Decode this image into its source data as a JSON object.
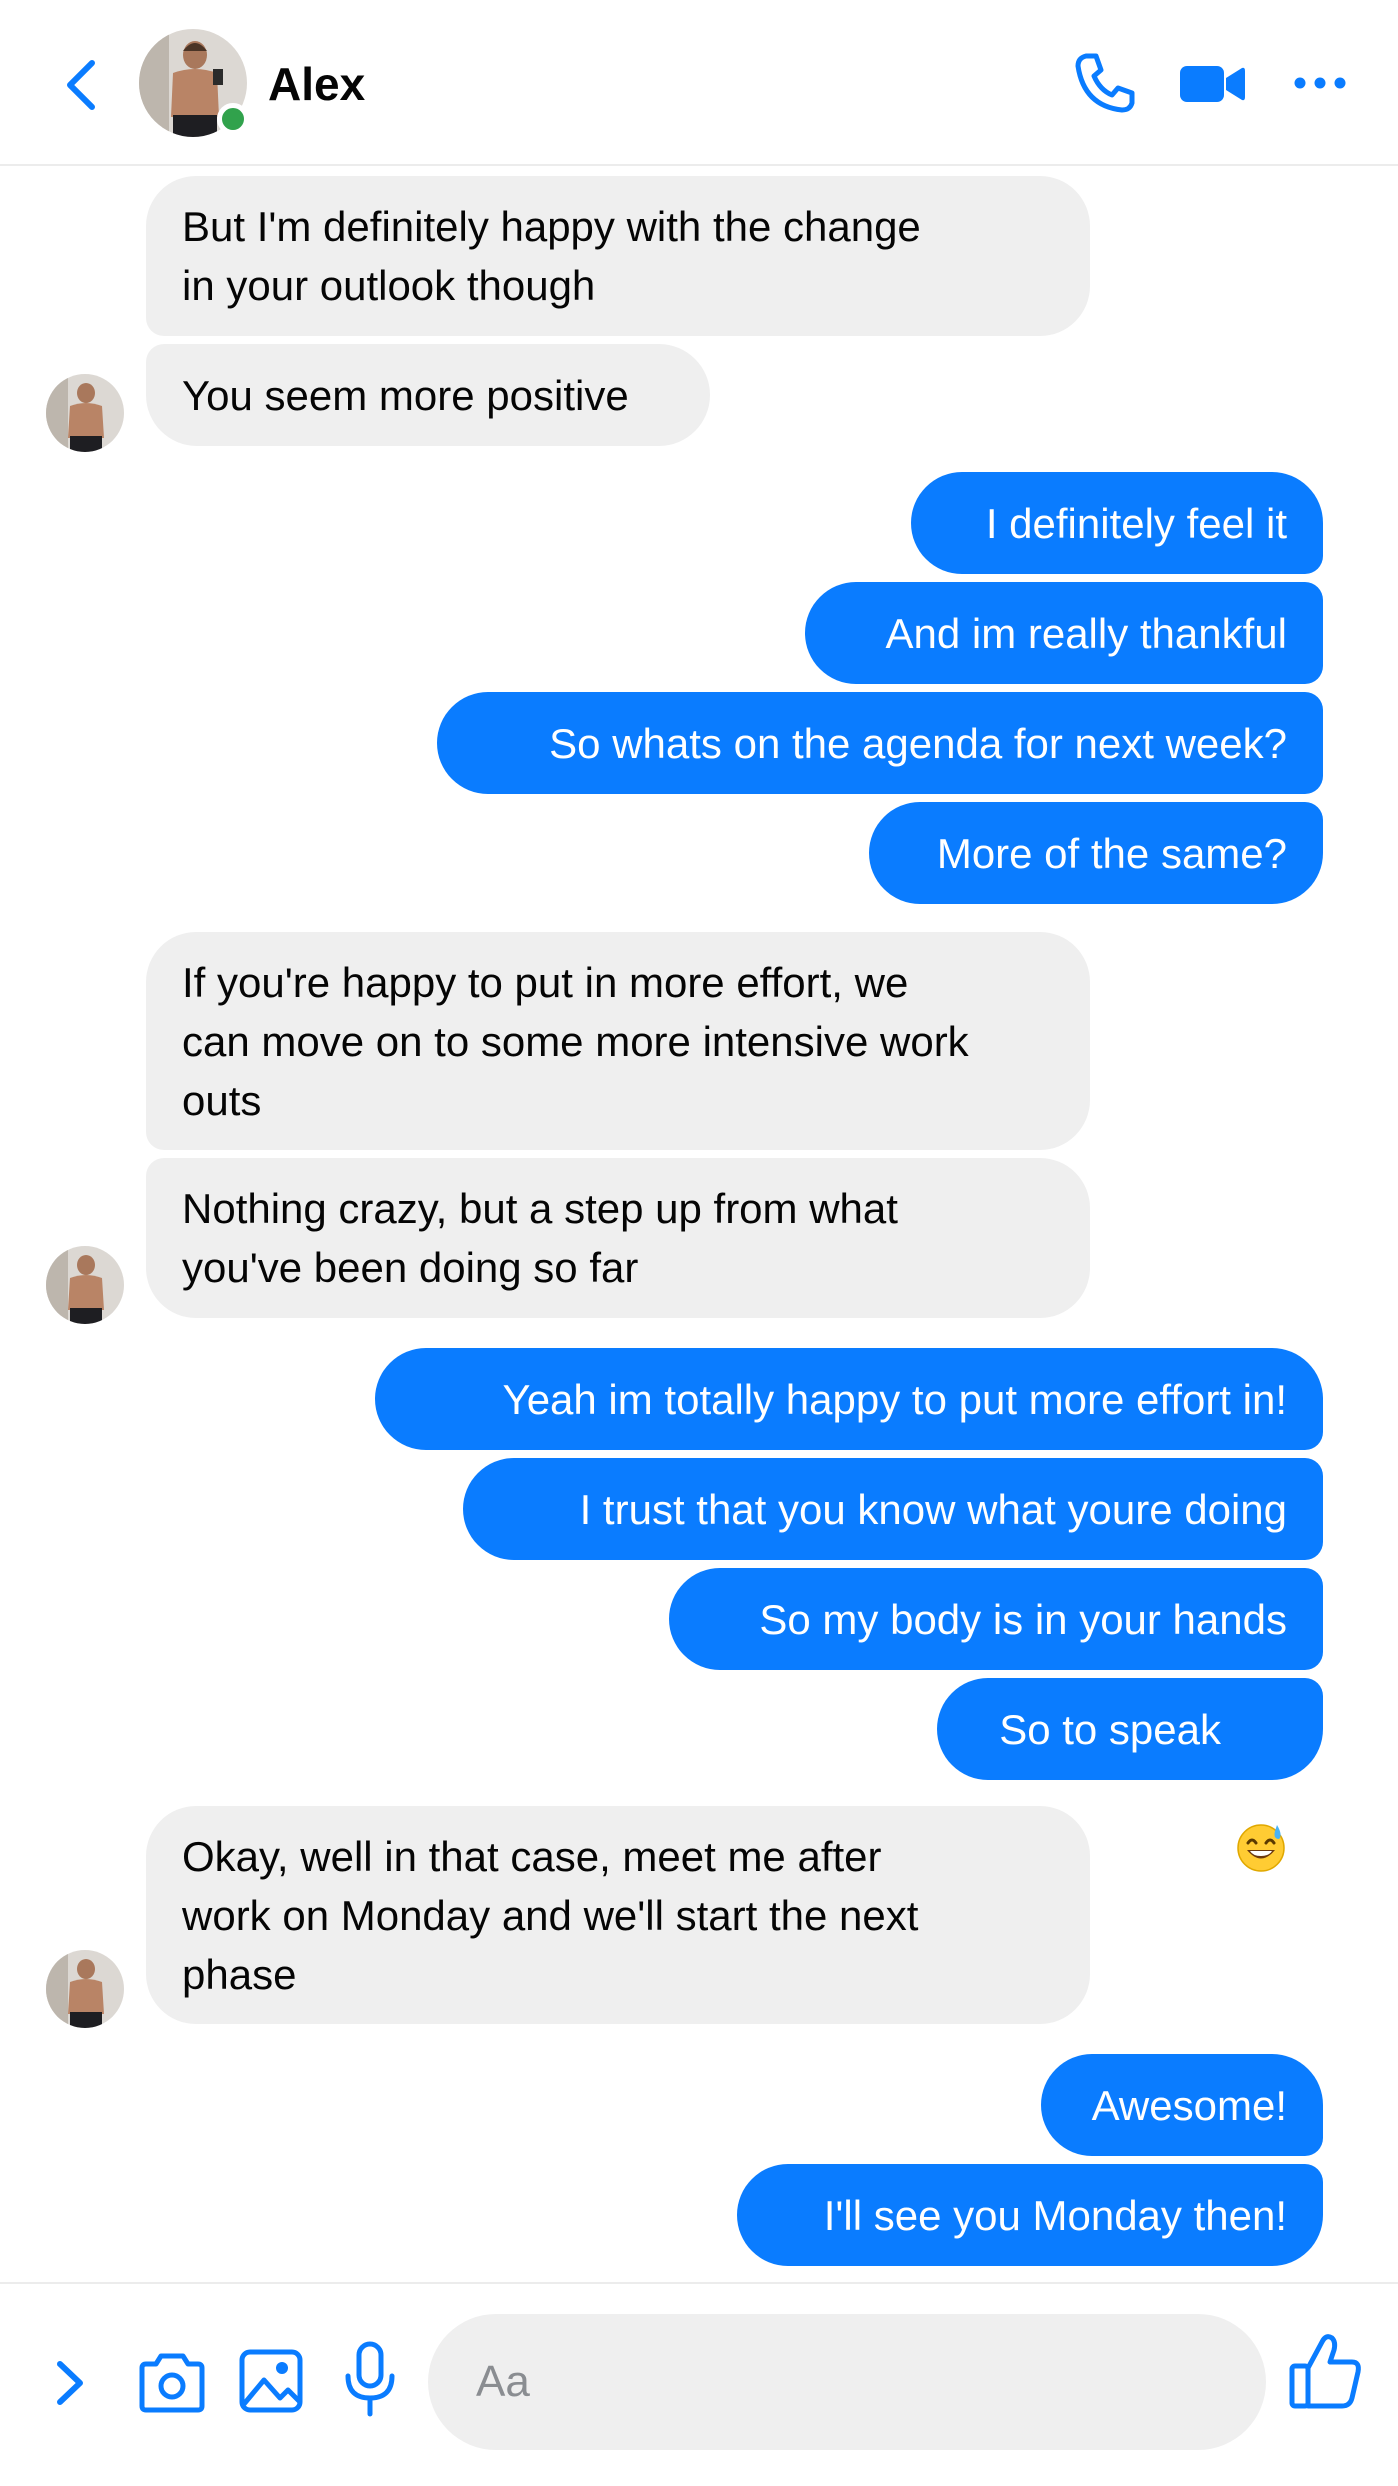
{
  "header": {
    "contact_name": "Alex",
    "online": true,
    "icons": [
      "back-chevron-icon",
      "phone-icon",
      "video-camera-icon",
      "more-dots-icon"
    ]
  },
  "messages": [
    {
      "side": "in",
      "text": "But I'm definitely happy with the change\nin your outlook though"
    },
    {
      "side": "in",
      "text": "You seem more positive"
    },
    {
      "side": "out",
      "text": "I definitely feel it"
    },
    {
      "side": "out",
      "text": "And im really thankful"
    },
    {
      "side": "out",
      "text": "So whats on the agenda for next week?"
    },
    {
      "side": "out",
      "text": "More of the same?"
    },
    {
      "side": "in",
      "text": "If you're happy to put in more effort, we\ncan move on to some more intensive work\nouts"
    },
    {
      "side": "in",
      "text": "Nothing crazy, but a step up from what\nyou've been doing so far"
    },
    {
      "side": "out",
      "text": "Yeah im totally happy to put more effort in!"
    },
    {
      "side": "out",
      "text": "I trust that you know what youre doing"
    },
    {
      "side": "out",
      "text": "So my body is in your hands"
    },
    {
      "side": "out",
      "text": "So to speak",
      "emoji": "grinning-sweat-emoji"
    },
    {
      "side": "in",
      "text": "Okay, well in that case, meet me after\nwork on Monday and we'll start the next\nphase"
    },
    {
      "side": "out",
      "text": "Awesome!"
    },
    {
      "side": "out",
      "text": "I'll see you Monday then!"
    }
  ],
  "composer": {
    "placeholder": "Aa",
    "value": "",
    "icons": [
      "chevron-right-icon",
      "camera-icon",
      "image-gallery-icon",
      "microphone-icon",
      "thumbs-up-icon"
    ]
  },
  "colors": {
    "accent": "#0a7cff",
    "incoming_bubble": "#efefef",
    "online": "#31a24c"
  }
}
